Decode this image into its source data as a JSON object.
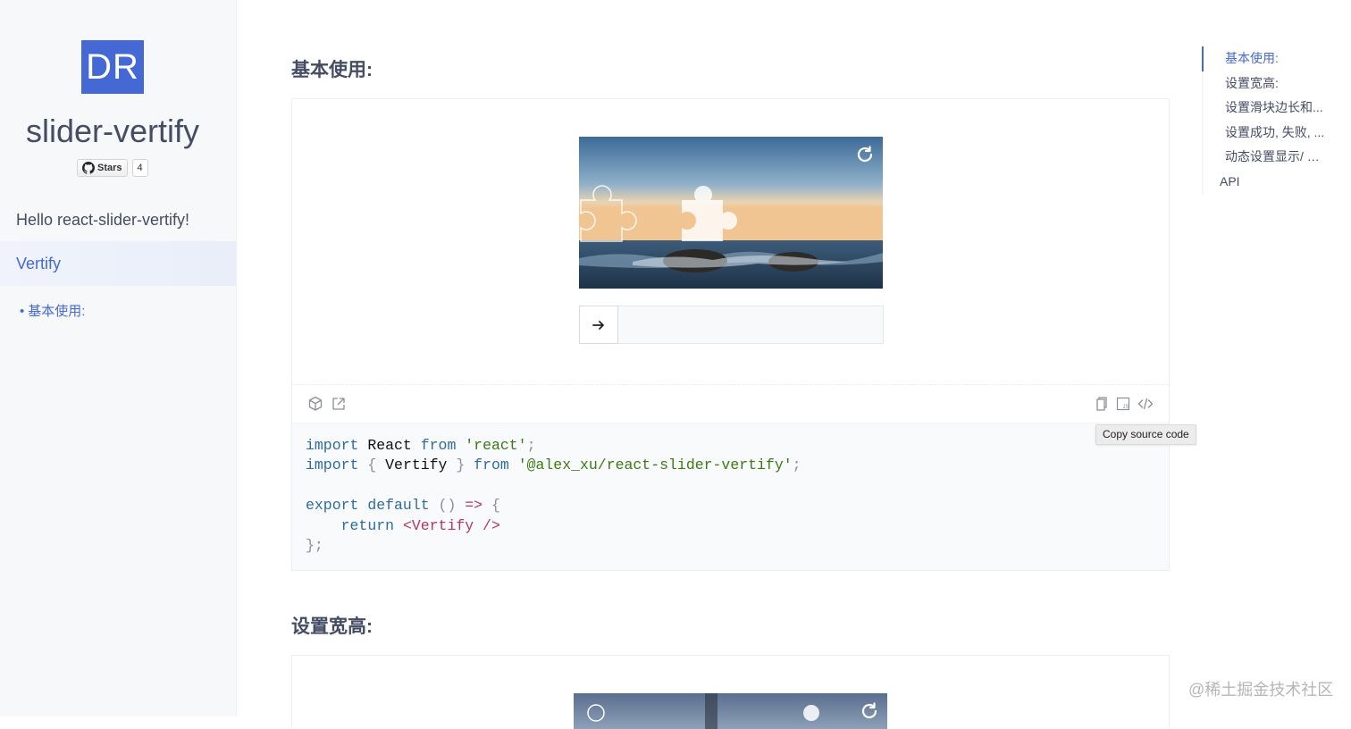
{
  "sidebar": {
    "logo_text": "DR",
    "title": "slider-vertify",
    "github": {
      "stars_label": "Stars",
      "stars_count": "4"
    },
    "nav": {
      "hello": "Hello react-slider-vertify!",
      "active": "Vertify",
      "sub_items": [
        {
          "label": "基本使用:"
        }
      ]
    }
  },
  "main": {
    "sections": [
      {
        "title": "基本使用:"
      },
      {
        "title": "设置宽高:"
      }
    ],
    "tooltip": "Copy source code",
    "code_lines": [
      "import React from 'react';",
      "import { Vertify } from '@alex_xu/react-slider-vertify';",
      "",
      "export default () => {",
      "    return <Vertify />",
      "};"
    ]
  },
  "toc": {
    "items": [
      {
        "label": "基本使用:",
        "active": true
      },
      {
        "label": "设置宽高:"
      },
      {
        "label": "设置滑块边长和..."
      },
      {
        "label": "设置成功, 失败, ..."
      },
      {
        "label": "动态设置显示/ 隐..."
      },
      {
        "label": "API"
      }
    ]
  },
  "watermark": "@稀土掘金技术社区",
  "colors": {
    "accent": "#4569d4",
    "sidebar_bg": "#f7f8fa",
    "text": "#454d64"
  },
  "icons": [
    "refresh-icon",
    "arrow-right-icon",
    "codesandbox-icon",
    "external-link-icon",
    "copy-icon",
    "js-file-icon",
    "code-icon",
    "github-icon"
  ]
}
